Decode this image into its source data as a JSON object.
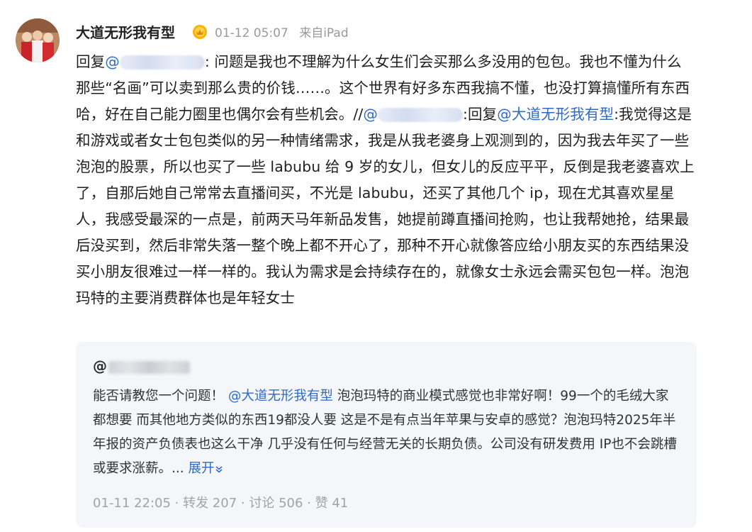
{
  "post": {
    "author": "大道无形我有型",
    "time": "01-12 05:07",
    "source": "来自iPad",
    "body": {
      "reply_prefix": "回复",
      "at_sign": "@",
      "part1": ": 问题是我也不理解为什么女生们会买那么多没用的包包。我也不懂为什么那些“名画”可以卖到那么贵的价钱……。这个世界有好多东西我搞不懂，也没打算搞懂所有东西哈，好在自己能力圈里也偶尔会有些机会。//",
      "part2": ":回复",
      "mention_self": "@大道无形我有型",
      "part3": ":我觉得这是和游戏或者女士包包类似的另一种情绪需求，我是从我老婆身上观测到的，因为我去年买了一些泡泡的股票，所以也买了一些 labubu 给 9 岁的女儿，但女儿的反应平平，反倒是我老婆喜欢上了，自那后她自己常常去直播间买，不光是 labubu，还买了其他几个 ip，现在尤其喜欢星星人，我感受最深的一点是，前两天马年新品发售，她提前蹲直播间抢购，也让我帮她抢，结果最后没买到，然后非常失落一整个晚上都不开心了，那种不开心就像答应给小朋友买的东西结果没买小朋友很难过一样一样的。我认为需求是会持续存在的，就像女士永远会需买包包一样。泡泡玛特的主要消费群体也是年轻女士"
    }
  },
  "quoted": {
    "user_prefix": "@",
    "text_before": "能否请教您一个问题！ ",
    "mention": "@大道无形我有型",
    "text_after": " 泡泡玛特的商业模式感觉也非常好啊！99一个的毛绒大家都想要 而其他地方类似的东西19都没人要 这是不是有点当年苹果与安卓的感觉？泡泡玛特2025年半年报的资产负债表也这么干净 几乎没有任何与经营无关的长期负债。公司没有研发费用 IP也不会跳槽或要求涨薪。... ",
    "expand_label": "展开",
    "time": "01-11 22:05",
    "repost": "· 转发 207",
    "comments": "· 讨论 506",
    "likes": "· 赞 41"
  },
  "colors": {
    "link": "#2f6bc7",
    "meta": "#9a9a9a",
    "card_bg": "#f5f6fa"
  }
}
